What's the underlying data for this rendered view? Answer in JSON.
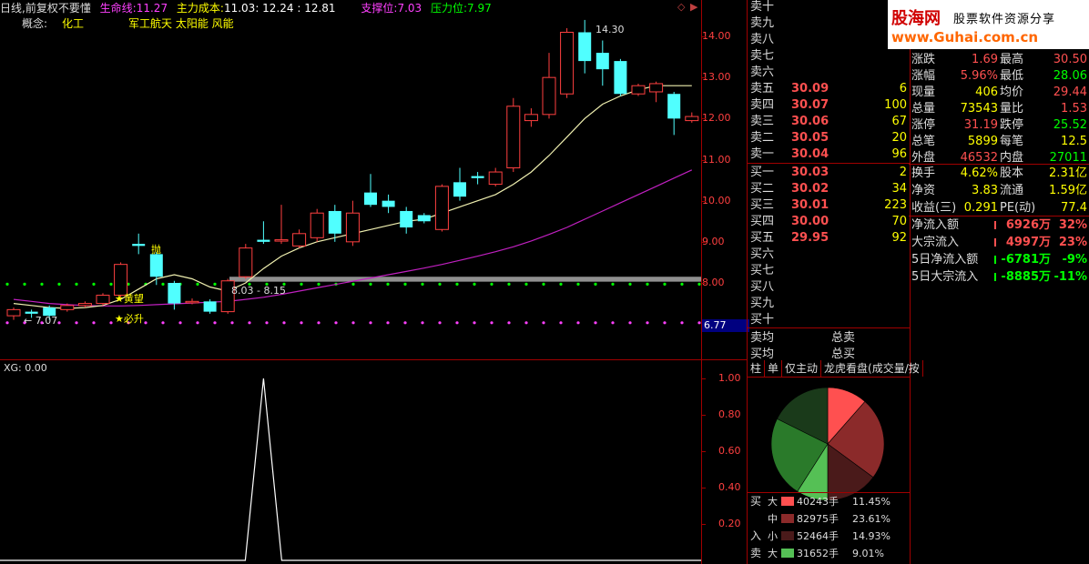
{
  "header": {
    "title": "日线,前复权",
    "indicator_name": "不要懂",
    "lifeline_label": "生命线:",
    "lifeline_value": "11.27",
    "main_cost_label": "主力成本:",
    "main_cost_value": "11.03",
    "main_cost_extra": ": 12.24 : 12.81",
    "support_label": "支撑位:",
    "support_value": "7.03",
    "pressure_label": "压力位:",
    "pressure_value": "7.97"
  },
  "concept": {
    "label": "概念:",
    "industry": "化工",
    "themes": "军工航天 太阳能 风能"
  },
  "price_axis": [
    "14.00",
    "13.00",
    "12.00",
    "11.00",
    "10.00",
    "9.00",
    "8.00"
  ],
  "price_badge": "6.77",
  "chart_labels": {
    "high_marker": "14.30",
    "low_marker": "7.07",
    "range_marker": "8.03 - 8.15",
    "sell_signal": "抛",
    "buy_signal_1": "★黄望",
    "buy_signal_2": "★必升"
  },
  "chart_data": {
    "type": "candlestick",
    "candles": [
      {
        "o": 7.2,
        "c": 7.35,
        "h": 7.4,
        "l": 7.1
      },
      {
        "o": 7.3,
        "c": 7.25,
        "h": 7.35,
        "l": 7.15
      },
      {
        "o": 7.4,
        "c": 7.2,
        "h": 7.45,
        "l": 7.1
      },
      {
        "o": 7.35,
        "c": 7.45,
        "h": 7.5,
        "l": 7.3
      },
      {
        "o": 7.45,
        "c": 7.5,
        "h": 7.55,
        "l": 7.4
      },
      {
        "o": 7.5,
        "c": 7.7,
        "h": 7.75,
        "l": 7.45
      },
      {
        "o": 7.7,
        "c": 8.45,
        "h": 8.5,
        "l": 7.65
      },
      {
        "o": 8.95,
        "c": 8.9,
        "h": 9.2,
        "l": 8.7
      },
      {
        "o": 8.7,
        "c": 8.15,
        "h": 8.75,
        "l": 7.95
      },
      {
        "o": 8.0,
        "c": 7.5,
        "h": 8.05,
        "l": 7.35
      },
      {
        "o": 7.55,
        "c": 7.55,
        "h": 7.62,
        "l": 7.48
      },
      {
        "o": 7.55,
        "c": 7.3,
        "h": 7.6,
        "l": 7.25
      },
      {
        "o": 7.3,
        "c": 8.05,
        "h": 8.1,
        "l": 7.25
      },
      {
        "o": 8.15,
        "c": 8.85,
        "h": 8.95,
        "l": 8.1
      },
      {
        "o": 9.05,
        "c": 9.0,
        "h": 9.5,
        "l": 8.95
      },
      {
        "o": 9.05,
        "c": 9.05,
        "h": 9.9,
        "l": 8.95
      },
      {
        "o": 8.9,
        "c": 9.2,
        "h": 9.3,
        "l": 8.85
      },
      {
        "o": 9.1,
        "c": 9.7,
        "h": 9.8,
        "l": 9.0
      },
      {
        "o": 9.75,
        "c": 9.2,
        "h": 9.9,
        "l": 9.0
      },
      {
        "o": 9.0,
        "c": 9.7,
        "h": 10.0,
        "l": 8.9
      },
      {
        "o": 10.2,
        "c": 9.9,
        "h": 10.65,
        "l": 9.85
      },
      {
        "o": 10.0,
        "c": 9.85,
        "h": 10.15,
        "l": 9.7
      },
      {
        "o": 9.75,
        "c": 9.35,
        "h": 9.85,
        "l": 9.2
      },
      {
        "o": 9.65,
        "c": 9.5,
        "h": 9.7,
        "l": 9.45
      },
      {
        "o": 9.3,
        "c": 10.35,
        "h": 10.4,
        "l": 9.25
      },
      {
        "o": 10.45,
        "c": 10.1,
        "h": 10.8,
        "l": 10.0
      },
      {
        "o": 10.6,
        "c": 10.55,
        "h": 10.7,
        "l": 10.4
      },
      {
        "o": 10.4,
        "c": 10.7,
        "h": 10.8,
        "l": 10.35
      },
      {
        "o": 10.8,
        "c": 12.3,
        "h": 12.5,
        "l": 10.7
      },
      {
        "o": 11.95,
        "c": 12.1,
        "h": 12.25,
        "l": 11.8
      },
      {
        "o": 12.1,
        "c": 13.0,
        "h": 13.6,
        "l": 12.0
      },
      {
        "o": 12.6,
        "c": 14.1,
        "h": 14.2,
        "l": 12.5
      },
      {
        "o": 14.1,
        "c": 13.4,
        "h": 14.4,
        "l": 13.1
      },
      {
        "o": 13.6,
        "c": 13.2,
        "h": 13.9,
        "l": 12.8
      },
      {
        "o": 13.4,
        "c": 12.6,
        "h": 13.45,
        "l": 12.55
      },
      {
        "o": 12.6,
        "c": 12.8,
        "h": 12.85,
        "l": 12.55
      },
      {
        "o": 12.65,
        "c": 12.85,
        "h": 12.9,
        "l": 12.4
      },
      {
        "o": 12.6,
        "c": 12.0,
        "h": 12.65,
        "l": 11.6
      },
      {
        "o": 11.95,
        "c": 12.05,
        "h": 12.15,
        "l": 11.9
      }
    ],
    "ma_fast": [
      7.5,
      7.45,
      7.4,
      7.38,
      7.4,
      7.45,
      7.6,
      7.85,
      8.1,
      8.2,
      8.1,
      7.9,
      7.8,
      8.0,
      8.35,
      8.65,
      8.85,
      9.0,
      9.1,
      9.2,
      9.3,
      9.4,
      9.5,
      9.55,
      9.7,
      9.85,
      10.0,
      10.15,
      10.4,
      10.7,
      11.1,
      11.55,
      12.0,
      12.35,
      12.55,
      12.7,
      12.8,
      12.8,
      12.8
    ],
    "ma_slow": [
      7.6,
      7.55,
      7.5,
      7.47,
      7.45,
      7.44,
      7.44,
      7.45,
      7.47,
      7.49,
      7.51,
      7.53,
      7.55,
      7.6,
      7.65,
      7.72,
      7.8,
      7.88,
      7.96,
      8.04,
      8.12,
      8.2,
      8.28,
      8.36,
      8.45,
      8.55,
      8.65,
      8.76,
      8.88,
      9.02,
      9.18,
      9.35,
      9.55,
      9.75,
      9.95,
      10.15,
      10.35,
      10.55,
      10.75
    ],
    "support_line": 7.03,
    "pressure_line": 7.97,
    "band_low": 8.03,
    "band_high": 8.15,
    "ylim": [
      6.6,
      15.0
    ]
  },
  "sub_chart": {
    "label": "XG: 0.00",
    "axis": [
      "1.00",
      "0.80",
      "0.60",
      "0.40",
      "0.20"
    ],
    "spike_index": 14
  },
  "order_book": {
    "sell": [
      {
        "label": "卖十",
        "price": "",
        "vol": ""
      },
      {
        "label": "卖九",
        "price": "",
        "vol": ""
      },
      {
        "label": "卖八",
        "price": "",
        "vol": ""
      },
      {
        "label": "卖七",
        "price": "",
        "vol": ""
      },
      {
        "label": "卖六",
        "price": "",
        "vol": ""
      },
      {
        "label": "卖五",
        "price": "30.09",
        "vol": "6"
      },
      {
        "label": "卖四",
        "price": "30.07",
        "vol": "100"
      },
      {
        "label": "卖三",
        "price": "30.06",
        "vol": "67"
      },
      {
        "label": "卖二",
        "price": "30.05",
        "vol": "20"
      },
      {
        "label": "卖一",
        "price": "30.04",
        "vol": "96"
      }
    ],
    "buy": [
      {
        "label": "买一",
        "price": "30.03",
        "vol": "2"
      },
      {
        "label": "买二",
        "price": "30.02",
        "vol": "34"
      },
      {
        "label": "买三",
        "price": "30.01",
        "vol": "223"
      },
      {
        "label": "买四",
        "price": "30.00",
        "vol": "70"
      },
      {
        "label": "买五",
        "price": "29.95",
        "vol": "92"
      },
      {
        "label": "买六",
        "price": "",
        "vol": ""
      },
      {
        "label": "买七",
        "price": "",
        "vol": ""
      },
      {
        "label": "买八",
        "price": "",
        "vol": ""
      },
      {
        "label": "买九",
        "price": "",
        "vol": ""
      },
      {
        "label": "买十",
        "price": "",
        "vol": ""
      }
    ],
    "sell_avg_label": "卖均",
    "buy_avg_label": "买均",
    "total_sell_label": "总卖",
    "total_buy_label": "总买"
  },
  "stats": [
    {
      "l1": "涨跌",
      "v1": "1.69",
      "c1": "#ff5050",
      "l2": "最高",
      "v2": "30.50",
      "c2": "#ff5050"
    },
    {
      "l1": "涨幅",
      "v1": "5.96%",
      "c1": "#ff5050",
      "l2": "最低",
      "v2": "28.06",
      "c2": "#00ff00"
    },
    {
      "l1": "现量",
      "v1": "406",
      "c1": "#ffff00",
      "l2": "均价",
      "v2": "29.44",
      "c2": "#ff5050"
    },
    {
      "l1": "总量",
      "v1": "73543",
      "c1": "#ffff00",
      "l2": "量比",
      "v2": "1.53",
      "c2": "#ff5050"
    },
    {
      "l1": "涨停",
      "v1": "31.19",
      "c1": "#ff5050",
      "l2": "跌停",
      "v2": "25.52",
      "c2": "#00ff00"
    },
    {
      "l1": "总笔",
      "v1": "5899",
      "c1": "#ffff00",
      "l2": "每笔",
      "v2": "12.5",
      "c2": "#ffff00"
    },
    {
      "l1": "外盘",
      "v1": "46532",
      "c1": "#ff5050",
      "l2": "内盘",
      "v2": "27011",
      "c2": "#00ff00"
    }
  ],
  "stats2": [
    {
      "l1": "换手",
      "v1": "4.62%",
      "c1": "#ffff00",
      "l2": "股本",
      "v2": "2.31亿",
      "c2": "#ffff00"
    },
    {
      "l1": "净资",
      "v1": "3.83",
      "c1": "#ffff00",
      "l2": "流通",
      "v2": "1.59亿",
      "c2": "#ffff00"
    },
    {
      "l1": "收益(三)",
      "v1": "0.291",
      "c1": "#ffff00",
      "l2": "PE(动)",
      "v2": "77.4",
      "c2": "#ffff00"
    }
  ],
  "flows": [
    {
      "label": "净流入额",
      "value": "6926万",
      "pct": "32%",
      "color": "#ff5050"
    },
    {
      "label": "大宗流入",
      "value": "4997万",
      "pct": "23%",
      "color": "#ff5050"
    },
    {
      "label": "5日净流入额",
      "value": "-6781万",
      "pct": "-9%",
      "color": "#00ff00"
    },
    {
      "label": "5日大宗流入",
      "value": "-8885万",
      "pct": "-11%",
      "color": "#00ff00"
    }
  ],
  "pie_tabs": [
    "柱",
    "单",
    "仅主动",
    "龙虎看盘(成交量/按"
  ],
  "pie": [
    {
      "label": "大",
      "side": "买",
      "value": 40243,
      "pct": "11.45%",
      "color": "#ff5050"
    },
    {
      "label": "中",
      "side": "买",
      "value": 82975,
      "pct": "23.61%",
      "color": "#8b2a2a"
    },
    {
      "label": "小",
      "side": "买",
      "value": 52464,
      "pct": "14.93%",
      "color": "#4a1a1a"
    },
    {
      "label": "大",
      "side": "卖",
      "value": 31652,
      "pct": "9.01%",
      "color": "#55c055"
    },
    {
      "label": "中",
      "side": "卖",
      "value": 82000,
      "pct": "",
      "color": "#2a7a2a"
    },
    {
      "label": "小",
      "side": "卖",
      "value": 62000,
      "pct": "",
      "color": "#1a3a1a"
    }
  ],
  "pie_legend": [
    {
      "side": "买",
      "size": "大",
      "value": "40243手",
      "pct": "11.45%",
      "color": "#ff5050"
    },
    {
      "side": "",
      "size": "中",
      "value": "82975手",
      "pct": "23.61%",
      "color": "#8b2a2a"
    },
    {
      "side": "入",
      "size": "小",
      "value": "52464手",
      "pct": "14.93%",
      "color": "#4a1a1a"
    },
    {
      "side": "卖",
      "size": "大",
      "value": "31652手",
      "pct": "9.01%",
      "color": "#55c055"
    }
  ],
  "logo": {
    "name": "股海网",
    "slogan": "股票软件资源分享",
    "url": "www.Guhai.com.cn"
  }
}
